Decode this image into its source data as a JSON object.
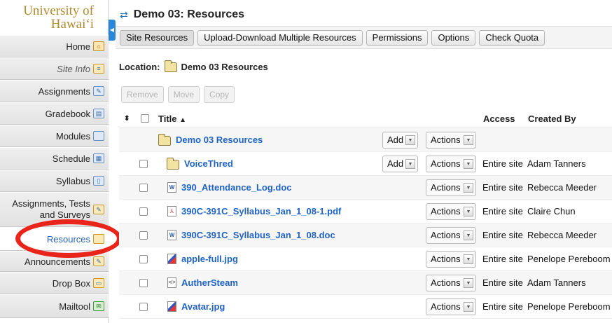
{
  "sidebar": {
    "logo_line1": "University of",
    "logo_line2": "Hawai‘i",
    "items": [
      {
        "label": "Home",
        "icon": "home-icon"
      },
      {
        "label": "Site Info",
        "icon": "site-info-icon"
      },
      {
        "label": "Assignments",
        "icon": "assignments-icon"
      },
      {
        "label": "Gradebook",
        "icon": "gradebook-icon"
      },
      {
        "label": "Modules",
        "icon": "modules-icon"
      },
      {
        "label": "Schedule",
        "icon": "schedule-icon"
      },
      {
        "label": "Syllabus",
        "icon": "syllabus-icon"
      },
      {
        "label": "Assignments, Tests and Surveys",
        "icon": "tests-icon"
      },
      {
        "label": "Resources",
        "icon": "resources-icon"
      },
      {
        "label": "Announcements",
        "icon": "announcements-icon"
      },
      {
        "label": "Drop Box",
        "icon": "dropbox-icon"
      },
      {
        "label": "Mailtool",
        "icon": "mailtool-icon"
      }
    ]
  },
  "header": {
    "title": "Demo 03: Resources"
  },
  "toolbar": {
    "buttons": [
      "Site Resources",
      "Upload-Download Multiple Resources",
      "Permissions",
      "Options",
      "Check Quota"
    ]
  },
  "location": {
    "label": "Location:",
    "folder": "Demo 03 Resources"
  },
  "actions": {
    "remove": "Remove",
    "move": "Move",
    "copy": "Copy"
  },
  "table": {
    "headers": {
      "title": "Title",
      "access": "Access",
      "created_by": "Created By"
    },
    "add_label": "Add",
    "actions_label": "Actions",
    "rows": [
      {
        "title": "Demo 03 Resources",
        "type": "folder-root",
        "access": "",
        "created_by": ""
      },
      {
        "title": "VoiceThred",
        "type": "folder",
        "access": "Entire site",
        "created_by": "Adam Tanners"
      },
      {
        "title": "390_Attendance_Log.doc",
        "type": "doc",
        "access": "Entire site",
        "created_by": "Rebecca Meeder"
      },
      {
        "title": "390C-391C_Syllabus_Jan_1_08-1.pdf",
        "type": "pdf",
        "access": "Entire site",
        "created_by": "Claire Chun"
      },
      {
        "title": "390C-391C_Syllabus_Jan_1_08.doc",
        "type": "doc",
        "access": "Entire site",
        "created_by": "Rebecca Meeder"
      },
      {
        "title": "apple-full.jpg",
        "type": "img",
        "access": "Entire site",
        "created_by": "Penelope Pereboom"
      },
      {
        "title": "AutherSteam",
        "type": "html",
        "access": "Entire site",
        "created_by": "Adam Tanners"
      },
      {
        "title": "Avatar.jpg",
        "type": "img",
        "access": "Entire site",
        "created_by": "Penelope Pereboom"
      }
    ]
  },
  "colors": {
    "link": "#1f63c4",
    "highlight": "#e8241b",
    "logo": "#b08a2e",
    "collapse_tab": "#2a86d9"
  }
}
